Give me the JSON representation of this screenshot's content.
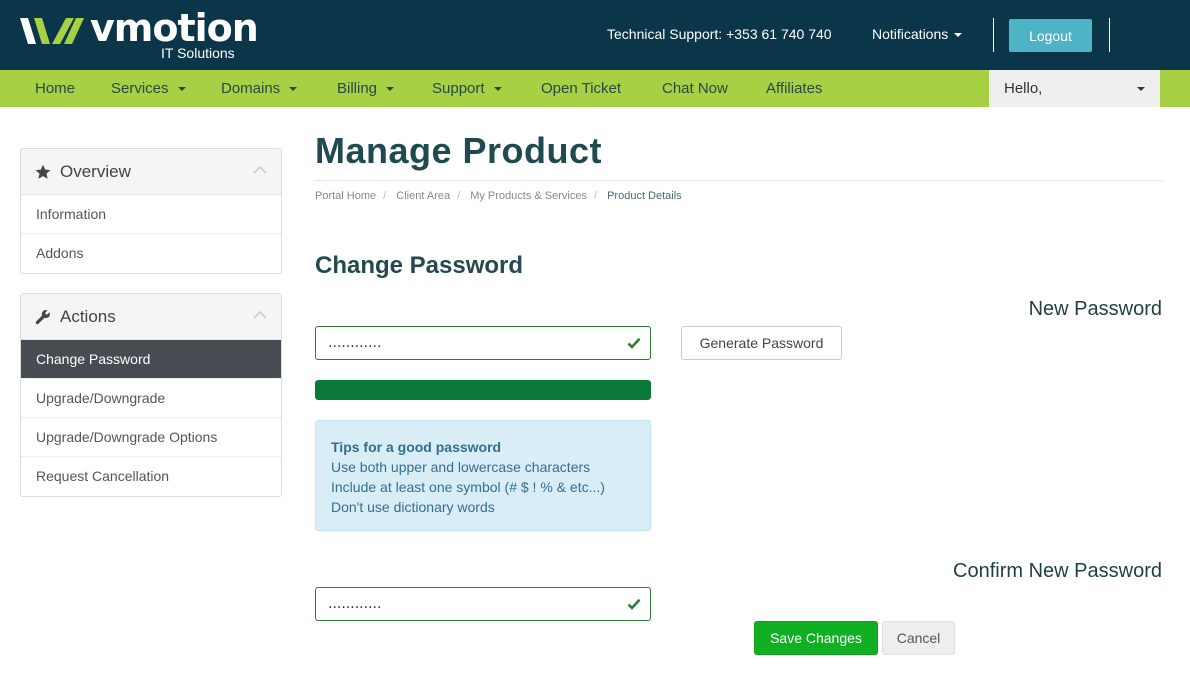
{
  "header": {
    "logo_word": "vmotion",
    "logo_sub": "IT Solutions",
    "support": "Technical Support: +353 61 740 740",
    "notifications": "Notifications",
    "logout": "Logout",
    "colors": {
      "bar": "#0b3548",
      "logout": "#4fb3c7",
      "logo_green": "#a8d045"
    }
  },
  "nav": {
    "items": [
      {
        "label": "Home"
      },
      {
        "label": "Services"
      },
      {
        "label": "Domains"
      },
      {
        "label": "Billing"
      },
      {
        "label": "Support"
      },
      {
        "label": "Open Ticket"
      },
      {
        "label": "Chat Now"
      },
      {
        "label": "Affiliates"
      }
    ],
    "hello": "Hello,",
    "color": "#a8d045"
  },
  "sidebar": {
    "overview": {
      "title": "Overview",
      "icon": "star-icon",
      "items": [
        "Information",
        "Addons"
      ]
    },
    "actions": {
      "title": "Actions",
      "icon": "wrench-icon",
      "items": [
        "Change Password",
        "Upgrade/Downgrade",
        "Upgrade/Downgrade Options",
        "Request Cancellation"
      ],
      "active": "Change Password"
    }
  },
  "main": {
    "title": "Manage Product",
    "breadcrumb": [
      "Portal Home",
      "Client Area",
      "My Products & Services",
      "Product Details"
    ],
    "section_title": "Change Password",
    "new_password_label": "New Password",
    "new_password_value": "............",
    "generate_label": "Generate Password",
    "strength_fraction": 1.0,
    "tips": {
      "title": "Tips for a good password",
      "lines": [
        "Use both upper and lowercase characters",
        "Include at least one symbol (# $ ! % & etc...)",
        "Don't use dictionary words"
      ]
    },
    "confirm_label": "Confirm New Password",
    "confirm_value": "............",
    "save_label": "Save Changes",
    "cancel_label": "Cancel",
    "colors": {
      "valid": "#2e7d32",
      "strength": "#0a7a38",
      "save": "#10b022"
    }
  }
}
